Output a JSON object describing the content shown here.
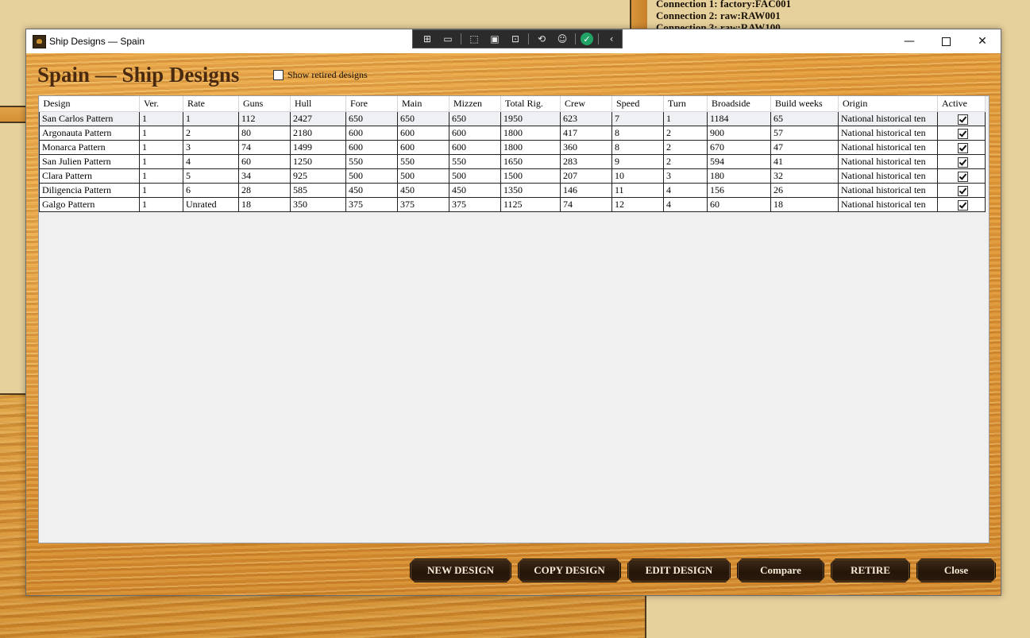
{
  "background": {
    "connections": [
      "Connection 1: factory:FAC001",
      "Connection 2: raw:RAW001",
      "Connection 3: raw:RAW100"
    ]
  },
  "window": {
    "title": "Ship Designs — Spain",
    "minimize": "—",
    "close": "✕"
  },
  "debug_toolbar": {
    "tools": [
      "live-tree-icon",
      "camera-icon",
      "select-element-icon",
      "display-layout-icon",
      "track-focus-icon",
      "hot-reload-icon",
      "accessibility-icon",
      "check-icon",
      "collapse-icon"
    ]
  },
  "page": {
    "title": "Spain — Ship Designs",
    "show_retired_label": "Show retired designs",
    "show_retired_checked": false
  },
  "grid": {
    "columns": [
      "Design",
      "Ver.",
      "Rate",
      "Guns",
      "Hull",
      "Fore",
      "Main",
      "Mizzen",
      "Total Rig.",
      "Crew",
      "Speed",
      "Turn",
      "Broadside",
      "Build weeks",
      "Origin",
      "Active"
    ],
    "rows": [
      {
        "design": "San Carlos Pattern",
        "ver": "1",
        "rate": "1",
        "guns": "112",
        "hull": "2427",
        "fore": "650",
        "main": "650",
        "mizzen": "650",
        "total_rig": "1950",
        "crew": "623",
        "speed": "7",
        "turn": "1",
        "broadside": "1184",
        "build_weeks": "65",
        "origin": "National historical ten",
        "active": true
      },
      {
        "design": "Argonauta Pattern",
        "ver": "1",
        "rate": "2",
        "guns": "80",
        "hull": "2180",
        "fore": "600",
        "main": "600",
        "mizzen": "600",
        "total_rig": "1800",
        "crew": "417",
        "speed": "8",
        "turn": "2",
        "broadside": "900",
        "build_weeks": "57",
        "origin": "National historical ten",
        "active": true
      },
      {
        "design": "Monarca Pattern",
        "ver": "1",
        "rate": "3",
        "guns": "74",
        "hull": "1499",
        "fore": "600",
        "main": "600",
        "mizzen": "600",
        "total_rig": "1800",
        "crew": "360",
        "speed": "8",
        "turn": "2",
        "broadside": "670",
        "build_weeks": "47",
        "origin": "National historical ten",
        "active": true
      },
      {
        "design": "San Julien Pattern",
        "ver": "1",
        "rate": "4",
        "guns": "60",
        "hull": "1250",
        "fore": "550",
        "main": "550",
        "mizzen": "550",
        "total_rig": "1650",
        "crew": "283",
        "speed": "9",
        "turn": "2",
        "broadside": "594",
        "build_weeks": "41",
        "origin": "National historical ten",
        "active": true
      },
      {
        "design": "Clara Pattern",
        "ver": "1",
        "rate": "5",
        "guns": "34",
        "hull": "925",
        "fore": "500",
        "main": "500",
        "mizzen": "500",
        "total_rig": "1500",
        "crew": "207",
        "speed": "10",
        "turn": "3",
        "broadside": "180",
        "build_weeks": "32",
        "origin": "National historical ten",
        "active": true
      },
      {
        "design": "Diligencia Pattern",
        "ver": "1",
        "rate": "6",
        "guns": "28",
        "hull": "585",
        "fore": "450",
        "main": "450",
        "mizzen": "450",
        "total_rig": "1350",
        "crew": "146",
        "speed": "11",
        "turn": "4",
        "broadside": "156",
        "build_weeks": "26",
        "origin": "National historical ten",
        "active": true
      },
      {
        "design": "Galgo Pattern",
        "ver": "1",
        "rate": "Unrated",
        "guns": "18",
        "hull": "350",
        "fore": "375",
        "main": "375",
        "mizzen": "375",
        "total_rig": "1125",
        "crew": "74",
        "speed": "12",
        "turn": "4",
        "broadside": "60",
        "build_weeks": "18",
        "origin": "National historical ten",
        "active": true
      }
    ]
  },
  "buttons": {
    "new_design": "NEW DESIGN",
    "copy_design": "COPY DESIGN",
    "edit_design": "EDIT DESIGN",
    "compare": "Compare",
    "retire": "RETIRE",
    "close": "Close"
  },
  "colors": {
    "title_text": "#4a2a0e",
    "button_bg": "#241509",
    "button_text": "#f7ecd6",
    "wood": "#dd9437"
  }
}
